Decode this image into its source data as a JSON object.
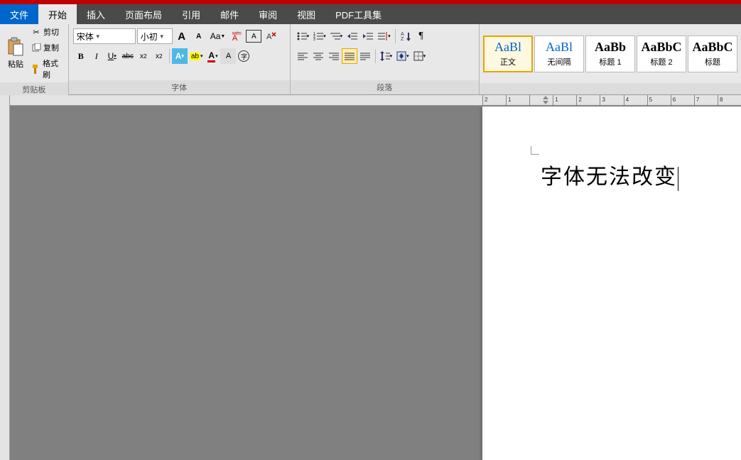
{
  "menu": {
    "file": "文件",
    "home": "开始",
    "insert": "插入",
    "layout": "页面布局",
    "ref": "引用",
    "mail": "邮件",
    "review": "审阅",
    "view": "视图",
    "pdf": "PDF工具集"
  },
  "clipboard": {
    "paste": "粘贴",
    "cut": "剪切",
    "copy": "复制",
    "format_painter": "格式刷",
    "group": "剪贴板"
  },
  "font": {
    "name": "宋体",
    "size": "小初",
    "grow": "A",
    "shrink": "A",
    "change_case": "Aa",
    "phonetic": "拼",
    "char_border": "A",
    "bold": "B",
    "italic": "I",
    "underline": "U",
    "strike": "abc",
    "sub": "x₂",
    "sup": "x²",
    "text_effect": "A",
    "highlight": "ab",
    "font_color": "A",
    "char_shade": "A",
    "enclose": "字",
    "clear": "清",
    "group": "字体"
  },
  "paragraph": {
    "bullets": "•",
    "numbering": "1.",
    "multilevel": "≡",
    "dec_indent": "◀",
    "inc_indent": "▶",
    "sort": "A↓",
    "show_marks": "¶",
    "align_l": "≡",
    "align_c": "≡",
    "align_r": "≡",
    "justify": "≡",
    "distrib": "≡",
    "line_space": "↕",
    "shade": "◧",
    "borders": "田",
    "group": "段落"
  },
  "styles": [
    {
      "preview": "AaBl",
      "label": "正文",
      "active": true
    },
    {
      "preview": "AaBl",
      "label": "无间隔",
      "active": false
    },
    {
      "preview": "AaBb",
      "label": "标题 1",
      "active": false
    },
    {
      "preview": "AaBbC",
      "label": "标题 2",
      "active": false
    },
    {
      "preview": "AaBbC",
      "label": "标题",
      "active": false
    }
  ],
  "ruler": {
    "ticks": [
      "2",
      "1",
      "",
      "1",
      "2",
      "3",
      "4",
      "5",
      "6",
      "7",
      "8"
    ]
  },
  "document": {
    "text": "字体无法改变"
  }
}
